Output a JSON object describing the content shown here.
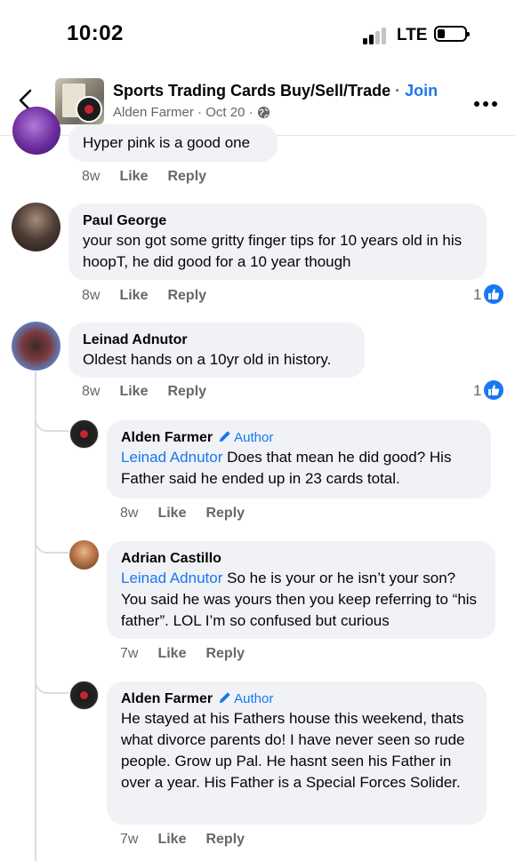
{
  "status_bar": {
    "time": "10:02",
    "network": "LTE"
  },
  "header": {
    "group_name": "Sports Trading Cards Buy/Sell/Trade",
    "separator": "·",
    "join_label": "Join",
    "author": "Alden Farmer",
    "date": "Oct 20",
    "privacy_icon": "globe-icon"
  },
  "actions": {
    "like": "Like",
    "reply": "Reply"
  },
  "comments": [
    {
      "name": "",
      "text": "Hyper pink is a good one",
      "time": "8w",
      "reactions": ""
    },
    {
      "name": "Paul George",
      "text": "your son got some gritty finger tips for 10 years old in his hoopT, he did good for a 10 year though",
      "time": "8w",
      "reactions": "1"
    },
    {
      "name": "Leinad Adnutor",
      "text": "Oldest hands on a 10yr old in history.",
      "time": "8w",
      "reactions": "1"
    }
  ],
  "replies": [
    {
      "name": "Alden Farmer",
      "badge": "Author",
      "mention": "Leinad Adnutor",
      "text": " Does that mean he did good? His Father said he ended up in 23 cards total.",
      "time": "8w"
    },
    {
      "name": "Adrian Castillo",
      "badge": "",
      "mention": "Leinad Adnutor",
      "text": " So he is your or he isn’t your son? You said he was yours then you keep referring to “his father”. LOL I’m so confused but curious",
      "time": "7w"
    },
    {
      "name": "Alden Farmer",
      "badge": "Author",
      "mention": "",
      "text": "He stayed at his Fathers house this weekend, thats what divorce parents do! I have never seen so rude people. Grow up Pal. He hasnt seen his Father in over a year. His Father is a Special Forces Solider.",
      "time": "7w"
    }
  ],
  "colors": {
    "accent": "#1877f2",
    "bubble": "#f0f2f5",
    "muted": "#65676b"
  }
}
